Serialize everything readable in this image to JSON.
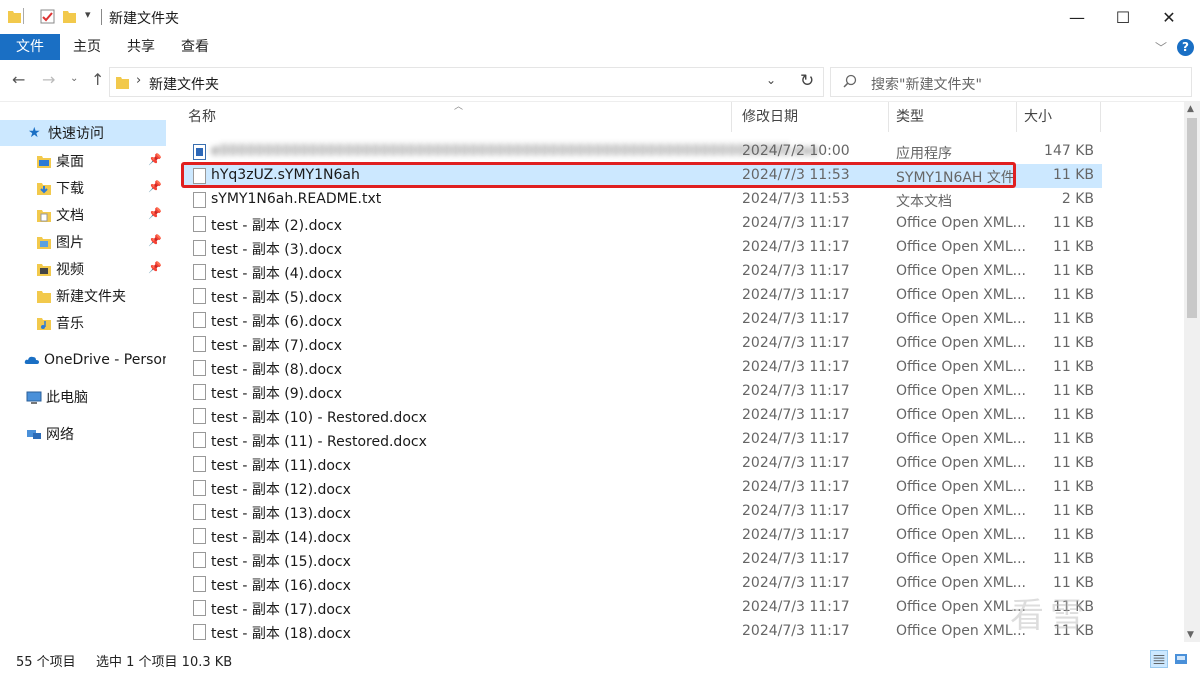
{
  "window": {
    "title": "新建文件夹",
    "minimize_label": "—",
    "maximize_label": "☐",
    "close_label": "✕"
  },
  "ribbon": {
    "tabs": [
      "文件",
      "主页",
      "共享",
      "查看"
    ],
    "expand_glyph": "﹀",
    "help_glyph": "?"
  },
  "address": {
    "path": "新建文件夹",
    "chevron": "›"
  },
  "search": {
    "placeholder": "搜索\"新建文件夹\""
  },
  "nav": {
    "quick_access": "快速访问",
    "items": [
      {
        "label": "桌面",
        "pinned": true
      },
      {
        "label": "下载",
        "pinned": true
      },
      {
        "label": "文档",
        "pinned": true
      },
      {
        "label": "图片",
        "pinned": true
      },
      {
        "label": "视频",
        "pinned": true
      },
      {
        "label": "新建文件夹",
        "pinned": false
      },
      {
        "label": "音乐",
        "pinned": false
      }
    ],
    "onedrive": "OneDrive - Personal",
    "this_pc": "此电脑",
    "network": "网络"
  },
  "columns": {
    "name": "名称",
    "date": "修改日期",
    "type": "类型",
    "size": "大小"
  },
  "files": [
    {
      "name": "e0000000000000000000000000000000000000000000000000000000000000000.exe",
      "date": "2024/7/2 10:00",
      "type": "应用程序",
      "size": "147 KB",
      "icon": "exe",
      "blurred": true
    },
    {
      "name": "hYq3zUZ.sYMY1N6ah",
      "date": "2024/7/3 11:53",
      "type": "SYMY1N6AH 文件",
      "size": "11 KB",
      "icon": "file",
      "selected": true
    },
    {
      "name": "sYMY1N6ah.README.txt",
      "date": "2024/7/3 11:53",
      "type": "文本文档",
      "size": "2 KB",
      "icon": "file"
    },
    {
      "name": "test - 副本 (2).docx",
      "date": "2024/7/3 11:17",
      "type": "Office Open XML...",
      "size": "11 KB",
      "icon": "file"
    },
    {
      "name": "test - 副本 (3).docx",
      "date": "2024/7/3 11:17",
      "type": "Office Open XML...",
      "size": "11 KB",
      "icon": "file"
    },
    {
      "name": "test - 副本 (4).docx",
      "date": "2024/7/3 11:17",
      "type": "Office Open XML...",
      "size": "11 KB",
      "icon": "file"
    },
    {
      "name": "test - 副本 (5).docx",
      "date": "2024/7/3 11:17",
      "type": "Office Open XML...",
      "size": "11 KB",
      "icon": "file"
    },
    {
      "name": "test - 副本 (6).docx",
      "date": "2024/7/3 11:17",
      "type": "Office Open XML...",
      "size": "11 KB",
      "icon": "file"
    },
    {
      "name": "test - 副本 (7).docx",
      "date": "2024/7/3 11:17",
      "type": "Office Open XML...",
      "size": "11 KB",
      "icon": "file"
    },
    {
      "name": "test - 副本 (8).docx",
      "date": "2024/7/3 11:17",
      "type": "Office Open XML...",
      "size": "11 KB",
      "icon": "file"
    },
    {
      "name": "test - 副本 (9).docx",
      "date": "2024/7/3 11:17",
      "type": "Office Open XML...",
      "size": "11 KB",
      "icon": "file"
    },
    {
      "name": "test - 副本 (10) - Restored.docx",
      "date": "2024/7/3 11:17",
      "type": "Office Open XML...",
      "size": "11 KB",
      "icon": "file"
    },
    {
      "name": "test - 副本 (11) - Restored.docx",
      "date": "2024/7/3 11:17",
      "type": "Office Open XML...",
      "size": "11 KB",
      "icon": "file"
    },
    {
      "name": "test - 副本 (11).docx",
      "date": "2024/7/3 11:17",
      "type": "Office Open XML...",
      "size": "11 KB",
      "icon": "file"
    },
    {
      "name": "test - 副本 (12).docx",
      "date": "2024/7/3 11:17",
      "type": "Office Open XML...",
      "size": "11 KB",
      "icon": "file"
    },
    {
      "name": "test - 副本 (13).docx",
      "date": "2024/7/3 11:17",
      "type": "Office Open XML...",
      "size": "11 KB",
      "icon": "file"
    },
    {
      "name": "test - 副本 (14).docx",
      "date": "2024/7/3 11:17",
      "type": "Office Open XML...",
      "size": "11 KB",
      "icon": "file"
    },
    {
      "name": "test - 副本 (15).docx",
      "date": "2024/7/3 11:17",
      "type": "Office Open XML...",
      "size": "11 KB",
      "icon": "file"
    },
    {
      "name": "test - 副本 (16).docx",
      "date": "2024/7/3 11:17",
      "type": "Office Open XML...",
      "size": "11 KB",
      "icon": "file"
    },
    {
      "name": "test - 副本 (17).docx",
      "date": "2024/7/3 11:17",
      "type": "Office Open XML...",
      "size": "11 KB",
      "icon": "file"
    },
    {
      "name": "test - 副本 (18).docx",
      "date": "2024/7/3 11:17",
      "type": "Office Open XML...",
      "size": "11 KB",
      "icon": "file"
    }
  ],
  "status": {
    "count": "55 个项目",
    "selection": "选中 1 个项目  10.3 KB"
  },
  "watermark": "看雪",
  "colors": {
    "accent": "#1a6fc4",
    "selection": "#cce8ff",
    "highlight_box": "#e02020",
    "folder": "#f2c94c"
  }
}
